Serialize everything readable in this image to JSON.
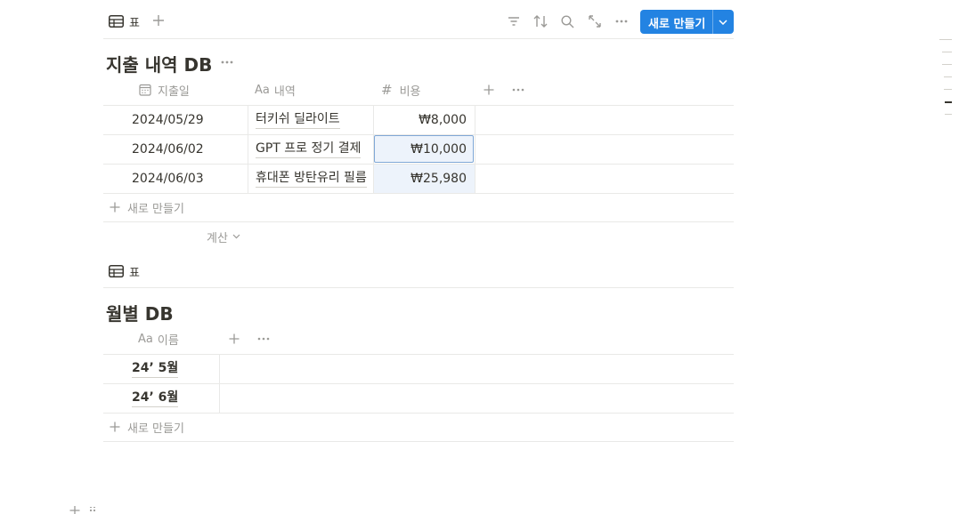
{
  "view_tab": {
    "label": "표"
  },
  "toolbar": {
    "new_button_label": "새로 만들기",
    "icons": [
      "filter-icon",
      "sort-icon",
      "search-icon",
      "expand-icon",
      "more-icon"
    ]
  },
  "db1": {
    "title": "지출 내역 DB",
    "columns": [
      {
        "icon": "calendar-icon",
        "label": "지출일"
      },
      {
        "icon": "text-icon",
        "icon_text": "Aa",
        "label": "내역"
      },
      {
        "icon": "number-icon",
        "icon_text": "#",
        "label": "비용"
      }
    ],
    "rows": [
      {
        "date": "2024/05/29",
        "item": "터키쉬 딜라이트",
        "cost": "₩8,000"
      },
      {
        "date": "2024/06/02",
        "item": "GPT 프로 정기 결제",
        "cost": "₩10,000"
      },
      {
        "date": "2024/06/03",
        "item": "휴대폰 방탄유리 필름",
        "cost": "₩25,980"
      }
    ],
    "new_row_label": "새로 만들기",
    "calc_label": "계산"
  },
  "db2": {
    "view_label": "표",
    "title": "월별 DB",
    "columns": [
      {
        "icon": "text-icon",
        "icon_text": "Aa",
        "label": "이름"
      }
    ],
    "rows": [
      {
        "name": "24’ 5월"
      },
      {
        "name": "24’ 6월"
      }
    ],
    "new_row_label": "새로 만들기"
  },
  "colors": {
    "accent": "#2383e2",
    "selected_cell_bg": "#edf3fb",
    "border": "#e9e9e7",
    "muted_text": "#9b9a97"
  }
}
